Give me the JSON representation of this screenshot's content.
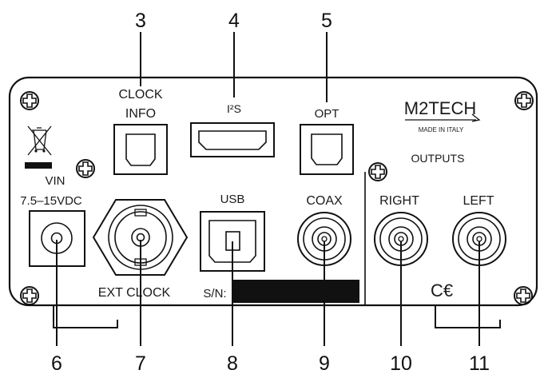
{
  "panel_labels": {
    "clock_line1": "CLOCK",
    "clock_line2": "INFO",
    "i2s": "I²S",
    "opt": "OPT",
    "brand": "M2TECH",
    "made_in": "MADE IN ITALY",
    "outputs": "OUTPUTS",
    "vin": "VIN",
    "vin_range": "7.5–15VDC",
    "usb": "USB",
    "coax": "COAX",
    "right": "RIGHT",
    "left": "LEFT",
    "ext_clock": "EXT CLOCK",
    "serial": "S/N:",
    "ce_mark": "C€"
  },
  "callouts": {
    "top": [
      "3",
      "4",
      "5"
    ],
    "bottom": [
      "6",
      "7",
      "8",
      "9",
      "10",
      "11"
    ]
  }
}
